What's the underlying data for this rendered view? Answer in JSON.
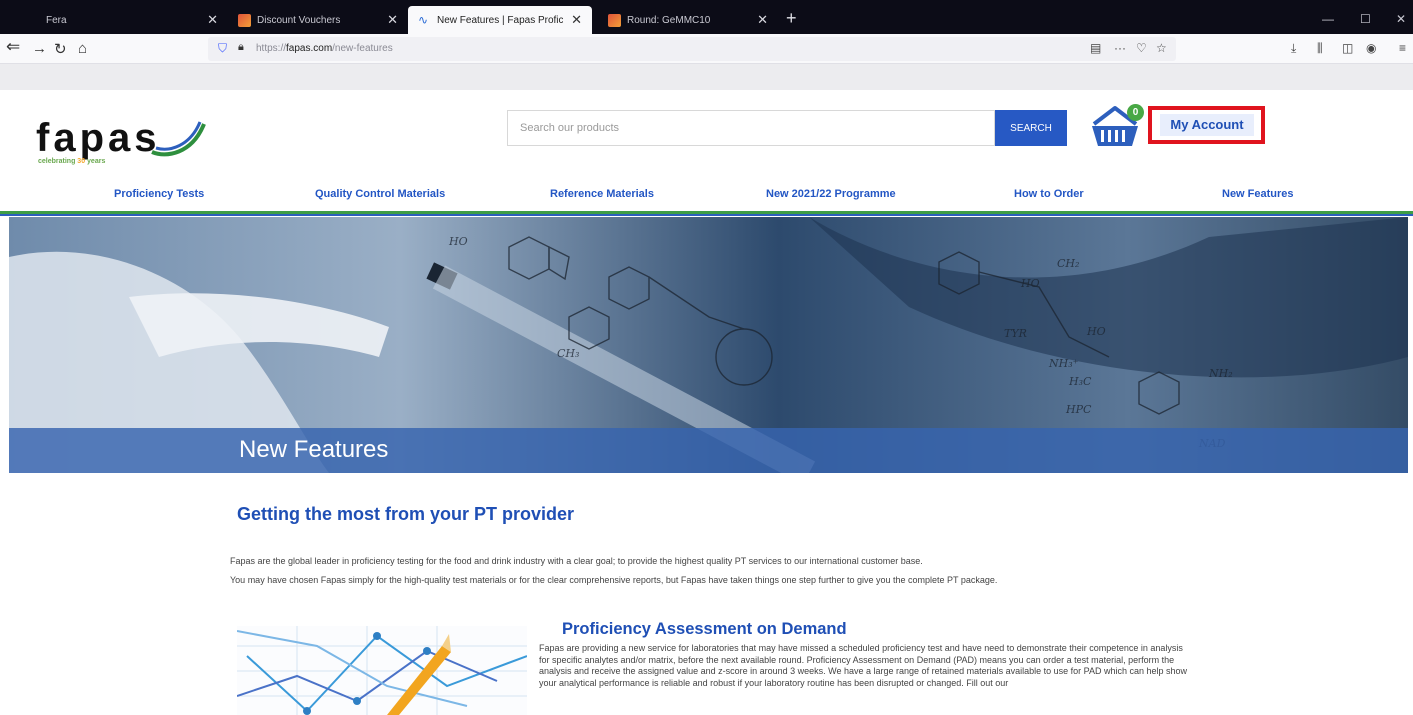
{
  "browser": {
    "tabs": [
      {
        "title": "Fera",
        "icon": "blank-icon",
        "active": false
      },
      {
        "title": "Discount Vouchers",
        "icon": "fapas-favicon",
        "active": false
      },
      {
        "title": "New Features | Fapas Proficien",
        "icon": "wave-favicon",
        "active": true
      },
      {
        "title": "Round: GeMMC10",
        "icon": "fapas-favicon",
        "active": false
      }
    ],
    "new_tab_label": "+",
    "url": {
      "scheme": "https://",
      "host": "fapas.com",
      "path": "/new-features"
    },
    "url_more_label": "···"
  },
  "site": {
    "logo": {
      "text": "fapas",
      "tagline_prefix": "celebrating ",
      "tagline_number": "30",
      "tagline_suffix": " years"
    },
    "search": {
      "placeholder": "Search our products",
      "button_label": "SEARCH"
    },
    "basket": {
      "count": "0"
    },
    "account_label": "My Account",
    "highlight_color": "#e0141e",
    "nav": [
      "Proficiency Tests",
      "Quality Control Materials",
      "Reference Materials",
      "New 2021/22 Programme",
      "How to Order",
      "New Features"
    ],
    "brand_blue": "#2356c4",
    "brand_green": "#3e9d46"
  },
  "hero": {
    "title": "New Features"
  },
  "content": {
    "heading": "Getting the most from your PT provider",
    "paragraph_1": "Fapas are the global leader in proficiency testing for the food and drink industry with a clear goal; to provide the highest quality PT services to our international customer base.",
    "paragraph_2": "You may have chosen Fapas simply for the high-quality test materials or for the clear comprehensive reports, but Fapas have taken things one step further to give you the complete PT package.",
    "pad": {
      "heading": "Proficiency Assessment on Demand",
      "text": "Fapas are providing a new service for laboratories that may have missed a scheduled proficiency test and have need to demonstrate their competence in analysis for specific analytes and/or matrix, before the next available round. Proficiency Assessment on Demand (PAD) means you can order a test material, perform the analysis and receive the assigned value and z-score in around 3 weeks. We have a large range of retained materials available to use for PAD which can help show your analytical performance is reliable and robust if your laboratory routine has been disrupted or changed. Fill out our"
    }
  }
}
